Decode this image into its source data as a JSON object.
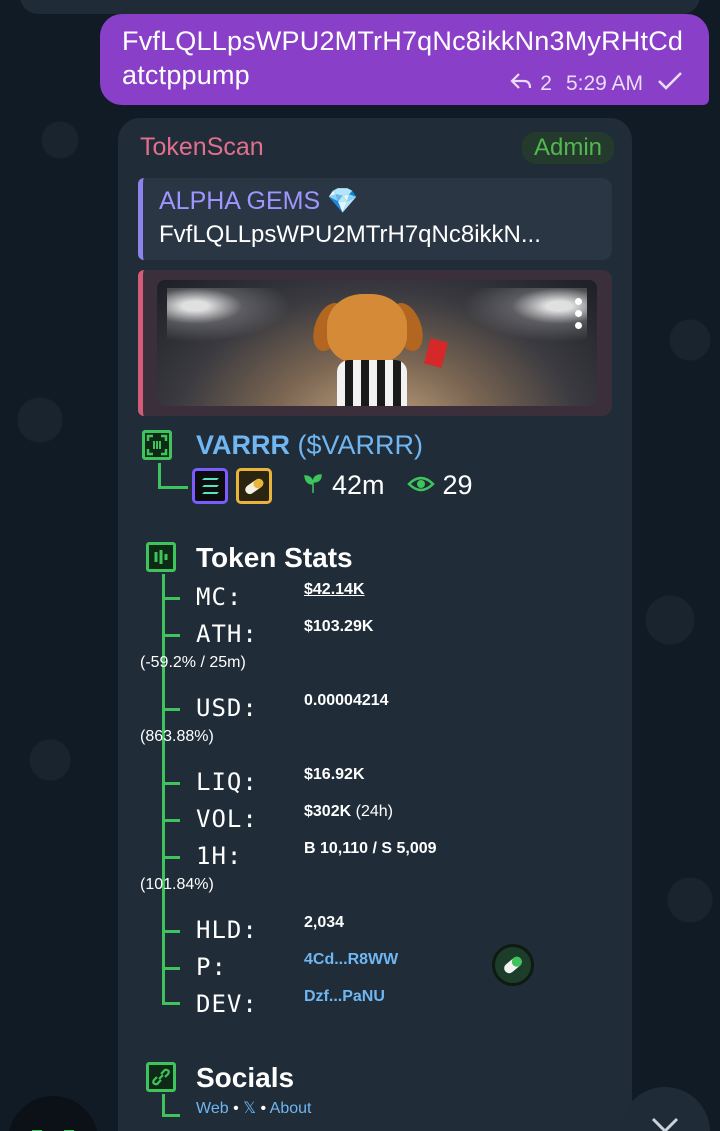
{
  "outgoing": {
    "text": "FvfLQLLpsWPU2MTrH7qNc8ikkNn3MyRHtCdatctppump",
    "reply_count": "2",
    "time": "5:29 AM",
    "check_icon": "check-icon"
  },
  "card": {
    "sender": "TokenScan",
    "badge": "Admin",
    "reply": {
      "title": "ALPHA GEMS 💎",
      "text": "FvfLQLLpsWPU2MTrH7qNc8ikkN..."
    },
    "token": {
      "name": "VARRR",
      "ticker": "($VARRR)",
      "age": "42m",
      "views": "29"
    },
    "stats": {
      "heading": "Token Stats",
      "mc_label": "MC:",
      "mc_value": "$42.14K",
      "ath_label": "ATH:",
      "ath_value": "$103.29K",
      "ath_change": "(-59.2% / 25m)",
      "usd_label": "USD:",
      "usd_value": "0.00004214",
      "usd_change": "(863.88%)",
      "liq_label": "LIQ:",
      "liq_value": "$16.92K",
      "vol_label": "VOL:",
      "vol_value": "$302K",
      "vol_period": "(24h)",
      "h1_label": "1H:",
      "h1_value": "B 10,110 / S 5,009",
      "h1_change": "(101.84%)",
      "hld_label": "HLD:",
      "hld_value": "2,034",
      "p_label": "P:",
      "p_value": "4Cd...R8WW",
      "dev_label": "DEV:",
      "dev_value": "Dzf...PaNU"
    },
    "socials": {
      "heading": "Socials",
      "web": "Web",
      "x": "𝕏",
      "about": "About",
      "sep": "•"
    }
  },
  "colors": {
    "accent_green": "#3fc35c",
    "link": "#6fb6f2",
    "bubble_out": "#8a3fc8",
    "sender": "#e26f8e"
  }
}
